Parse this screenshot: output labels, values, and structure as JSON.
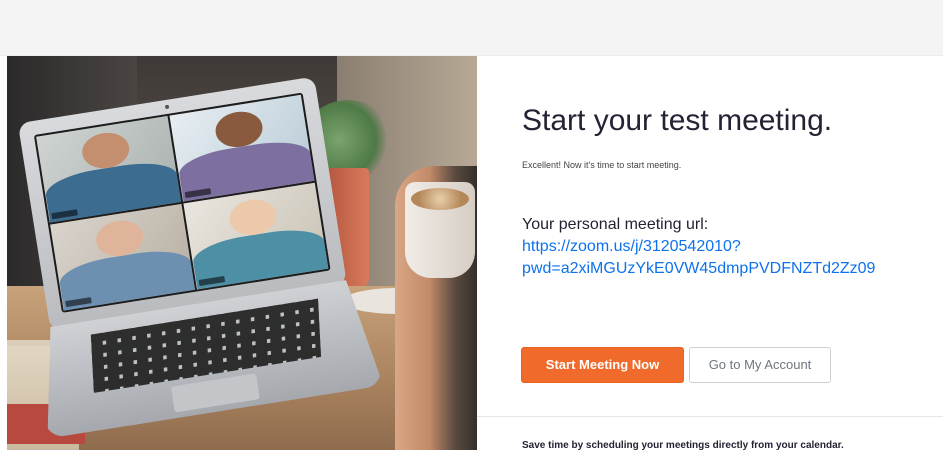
{
  "main": {
    "title": "Start your test meeting.",
    "subtitle": "Excellent! Now it's time to start meeting.",
    "url_label": "Your personal meeting url:",
    "url_line1": "https://zoom.us/j/3120542010?",
    "url_line2": "pwd=a2xiMGUzYkE0VW45dmpPVDFNZTd2Zz09",
    "start_button": "Start Meeting Now",
    "account_button": "Go to My Account",
    "footer_note": "Save time by scheduling your meetings directly from your calendar."
  },
  "colors": {
    "primary_orange": "#f06a2b",
    "link_blue": "#0e72ed",
    "text_dark": "#232333"
  }
}
